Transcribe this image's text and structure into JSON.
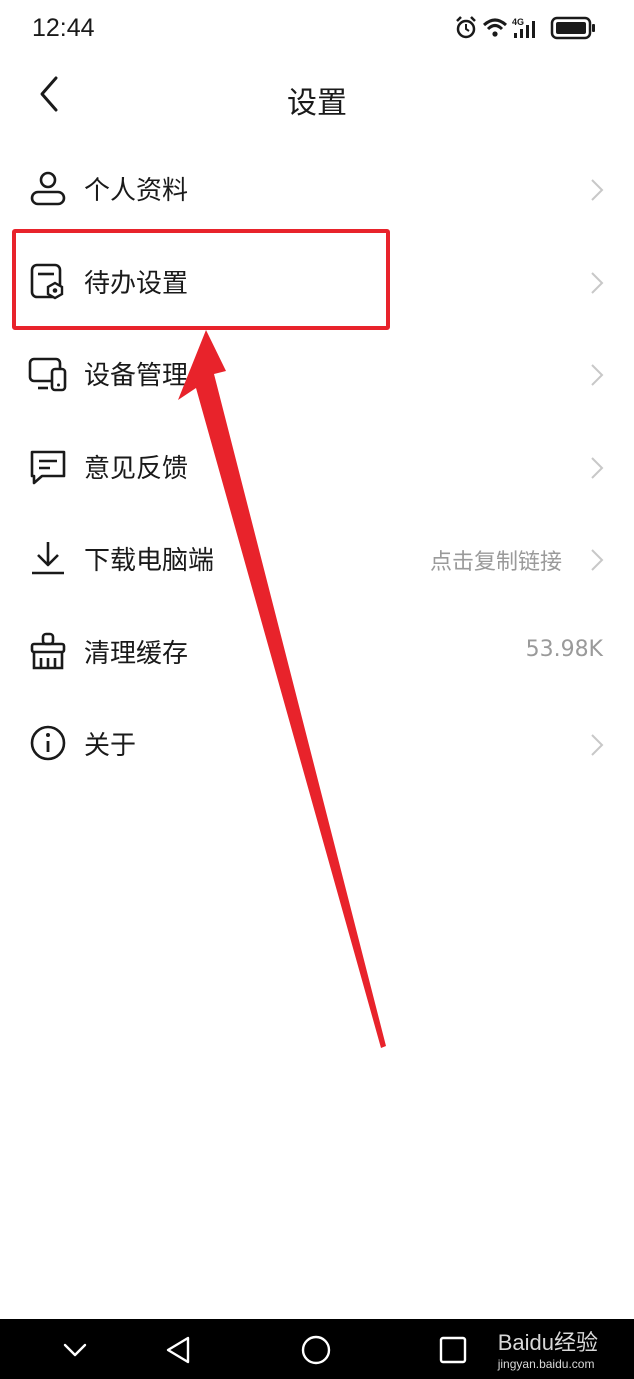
{
  "status_bar": {
    "time": "12:44",
    "network_badge": "4G",
    "icons": [
      "alarm-icon",
      "wifi-icon",
      "signal-icon",
      "battery-icon"
    ]
  },
  "header": {
    "title": "设置",
    "back_icon": "chevron-left-icon"
  },
  "settings": {
    "items": [
      {
        "label": "个人资料",
        "icon": "user-icon",
        "value": ""
      },
      {
        "label": "待办设置",
        "icon": "todo-settings-icon",
        "value": ""
      },
      {
        "label": "设备管理",
        "icon": "devices-icon",
        "value": ""
      },
      {
        "label": "意见反馈",
        "icon": "feedback-icon",
        "value": ""
      },
      {
        "label": "下载电脑端",
        "icon": "download-icon",
        "value": "点击复制链接"
      },
      {
        "label": "清理缓存",
        "icon": "broom-icon",
        "value": "53.98K"
      },
      {
        "label": "关于",
        "icon": "info-icon",
        "value": ""
      }
    ]
  },
  "annotation": {
    "highlight_color": "#e8232b"
  },
  "nav_bar": {
    "icons": [
      "nav-down-icon",
      "nav-back-icon",
      "nav-home-icon",
      "nav-recents-icon"
    ]
  },
  "watermark": {
    "brand": "Baidu经验",
    "url": "jingyan.baidu.com"
  }
}
